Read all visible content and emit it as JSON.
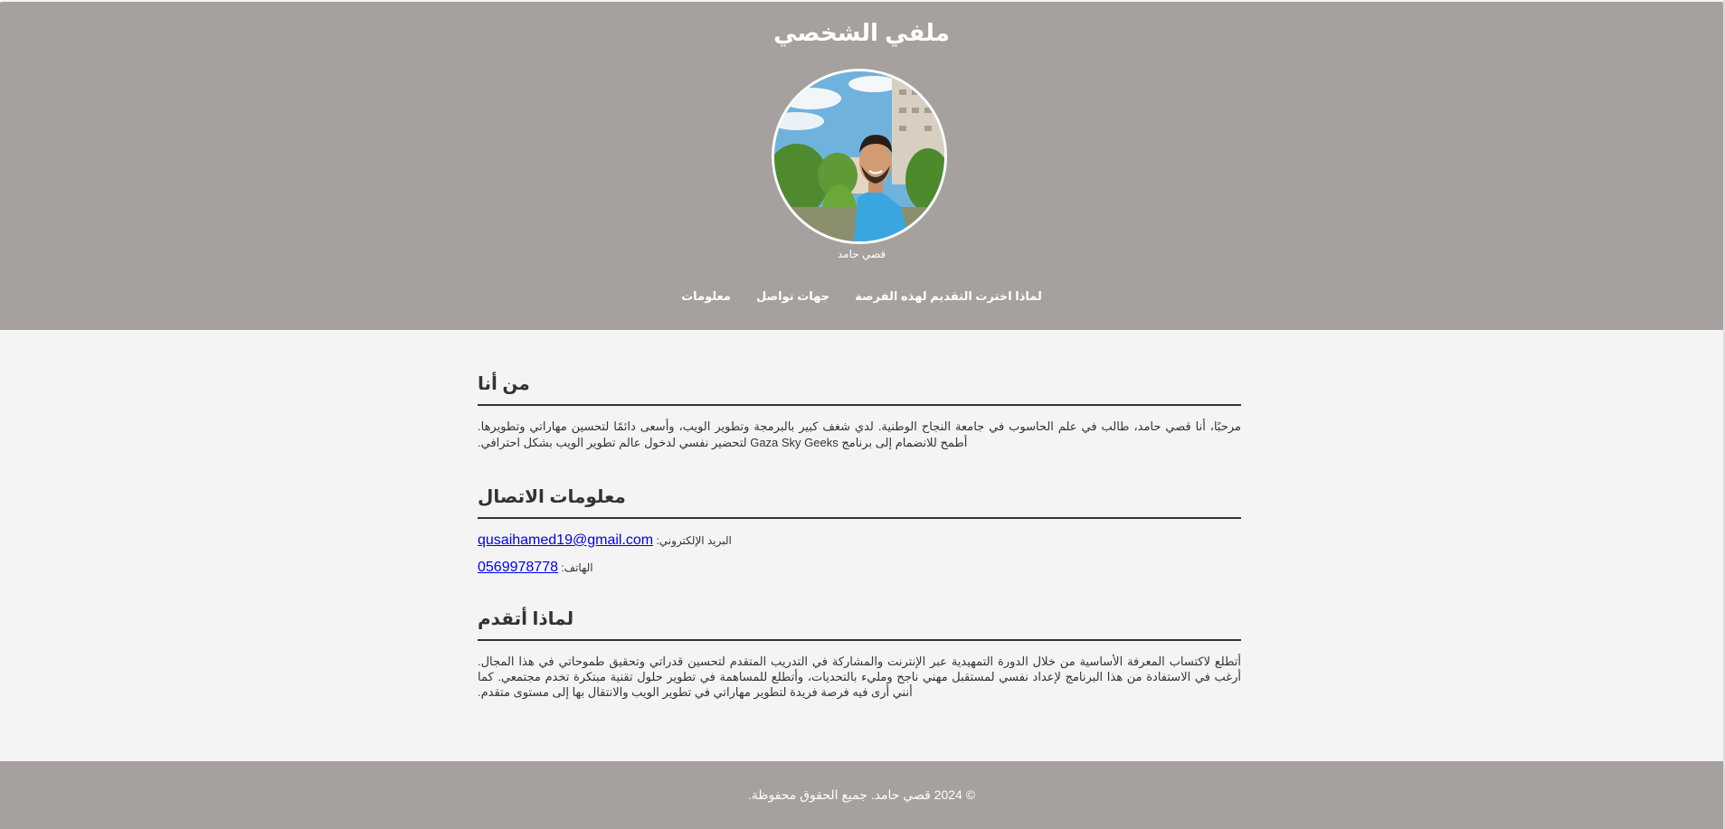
{
  "header": {
    "title": "ملفي الشخصي",
    "photo_caption": "قصي حامد",
    "nav": [
      {
        "label": "لماذا اخترت التقديم لهذه الفرصة"
      },
      {
        "label": "جهات تواصل"
      },
      {
        "label": "معلومات"
      }
    ]
  },
  "about": {
    "heading": "من أنا",
    "text": "مرحبًا، أنا قصي حامد، طالب في علم الحاسوب في جامعة النجاح الوطنية. لدي شغف كبير بالبرمجة وتطوير الويب، وأسعى دائمًا لتحسين مهاراتي وتطويرها. أطمح للانضمام إلى برنامج Gaza Sky Geeks لتحضير نفسي لدخول عالم تطوير الويب بشكل احترافي."
  },
  "contact": {
    "heading": "معلومات الاتصال",
    "email_label": "البريد الإلكتروني:",
    "email": "qusaihamed19@gmail.com",
    "phone_label": "الهاتف:",
    "phone": "0569978778"
  },
  "why": {
    "heading": "لماذا أتقدم",
    "text": "أتطلع لاكتساب المعرفة الأساسية من خلال الدورة التمهيدية عبر الإنترنت والمشاركة في التدريب المتقدم لتحسين قدراتي وتحقيق طموحاتي في هذا المجال. أرغب في الاستفادة من هذا البرنامج لإعداد نفسي لمستقبل مهني ناجح ومليء بالتحديات، وأتطلع للمساهمة في تطوير حلول تقنية مبتكرة تخدم مجتمعي. كما أنني أرى فيه فرصة فريدة لتطوير مهاراتي في تطوير الويب والانتقال بها إلى مستوى متقدم."
  },
  "footer": {
    "text": "© 2024 قصي حامد. جميع الحقوق محفوظة."
  },
  "colors": {
    "header_bg": "#a6a09f",
    "page_bg": "#f4f4f4",
    "text": "#333333",
    "link": "#0000ee"
  }
}
